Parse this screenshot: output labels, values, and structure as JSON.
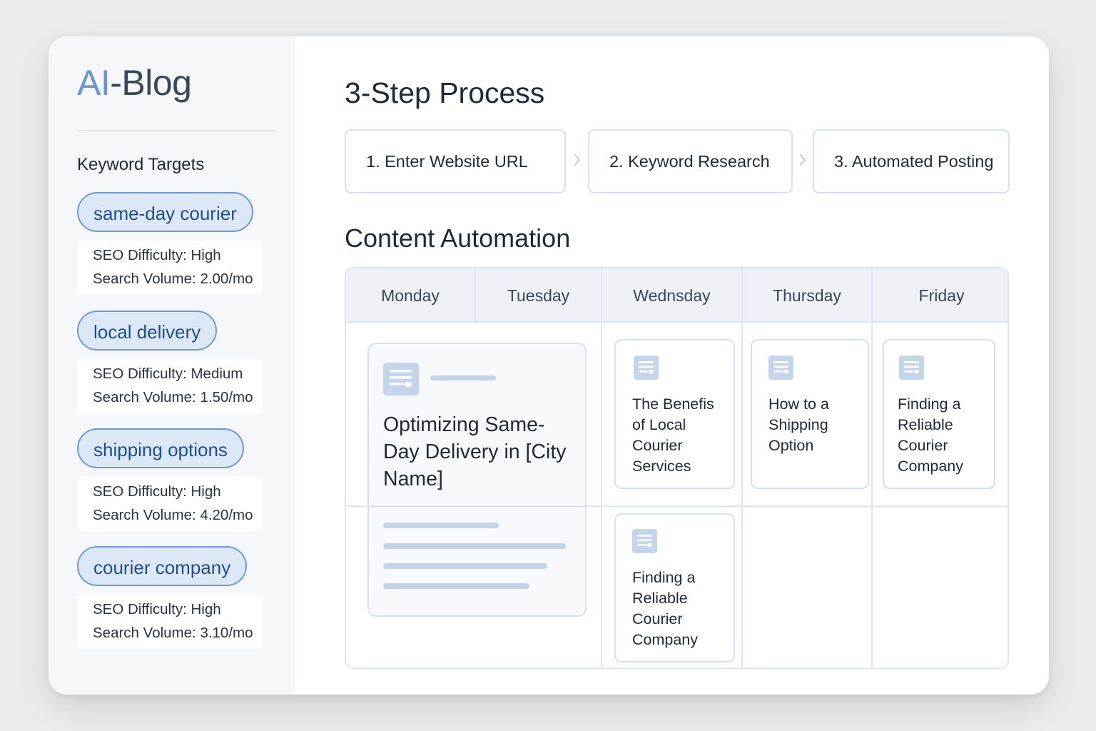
{
  "brand": {
    "logo_prefix": "AI",
    "logo_suffix": "-Blog",
    "accent_color": "#6b95cc"
  },
  "sidebar": {
    "heading": "Keyword Targets",
    "keywords": [
      {
        "label": "same-day courier",
        "difficulty": "SEO Difficulty: High",
        "volume_label": "Search Volume:",
        "volume_value": "2.00/mo"
      },
      {
        "label": "local delivery",
        "difficulty": "SEO Difficulty: Medium",
        "volume_label": "Search Volume:",
        "volume_value": "1.50/mo"
      },
      {
        "label": "shipping options",
        "difficulty": "SEO Difficulty: High",
        "volume_label": "Search Volume:",
        "volume_value": "4.20/mo"
      },
      {
        "label": "courier company",
        "difficulty": "SEO Difficulty: High",
        "volume_label": "Search Volume:",
        "volume_value": "3.10/mo"
      }
    ]
  },
  "process": {
    "title": "3-Step Process",
    "steps": [
      "1. Enter Website URL",
      "2. Keyword Research",
      "3. Automated Posting"
    ]
  },
  "content": {
    "title": "Content Automation",
    "days": [
      "Monday",
      "Tuesday",
      "Wednsday",
      "Thursday",
      "Friday"
    ],
    "featured_post": {
      "title": "Optimizing Same-Day Delivery in [City Name]",
      "icon": "document-icon"
    },
    "posts": [
      {
        "title": "The Benefis of Local Courier Services",
        "day": "Wednsday",
        "icon": "document-icon"
      },
      {
        "title": "How to a Shipping Option",
        "day": "Thursday",
        "icon": "document-icon"
      },
      {
        "title": "Finding a Reliable Courier Company",
        "day": "Friday",
        "icon": "document-icon"
      },
      {
        "title": "Finding a Reliable Courier Company",
        "day": "Wednsday",
        "icon": "document-icon"
      }
    ]
  }
}
